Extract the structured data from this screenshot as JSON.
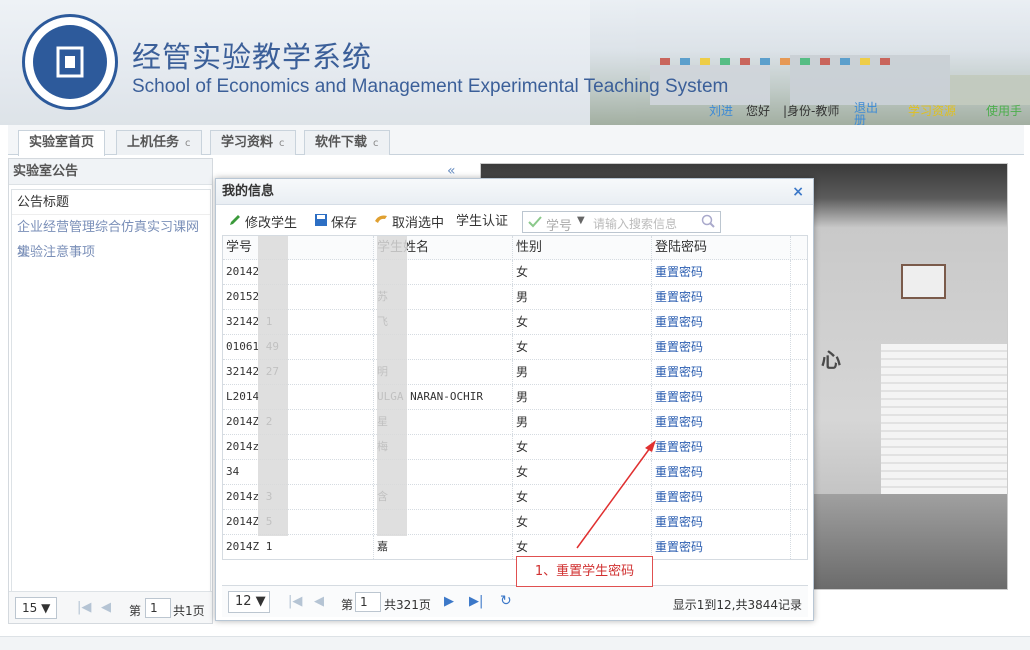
{
  "header": {
    "title_cn": "经管实验教学系统",
    "title_en": "School of Economics and Management Experimental Teaching System",
    "user": {
      "name": "刘进",
      "greeting": "您好",
      "identity": "|身份-教师",
      "logout": "退出",
      "logout2": "册",
      "link_yellow": "学习资源",
      "help": "使用手"
    }
  },
  "tabs": [
    {
      "label": "实验室首页"
    },
    {
      "label": "上机任务",
      "refresh": "c"
    },
    {
      "label": "学习资料",
      "refresh": "c"
    },
    {
      "label": "软件下载",
      "refresh": "c"
    }
  ],
  "left_panel": {
    "title": "实验室公告",
    "items": [
      "公告标题",
      "企业经营管理综合仿真实习课网址",
      "实验注意事项"
    ],
    "pager": {
      "size": "15 ▼",
      "page_prefix": "第",
      "page": "1",
      "total": "共1页"
    }
  },
  "collapse_icon": "«",
  "dialog": {
    "title": "我的信息",
    "close": "×",
    "toolbar": {
      "edit": "修改学生",
      "save": "保存",
      "cancel": "取消选中",
      "auth": "学生认证",
      "field": "学号",
      "placeholder": "请输入搜索信息"
    },
    "columns": [
      "学号",
      "学生姓名",
      "性别",
      "登陆密码"
    ],
    "rows": [
      {
        "id": "20142",
        "name": "",
        "gender": "女",
        "action": "重置密码"
      },
      {
        "id": "20152",
        "name": "苏",
        "gender": "男",
        "action": "重置密码"
      },
      {
        "id": "32142      1",
        "name": "飞",
        "gender": "女",
        "action": "重置密码"
      },
      {
        "id": "01061      49",
        "name": "",
        "gender": "女",
        "action": "重置密码"
      },
      {
        "id": "32142      27",
        "name": "明",
        "gender": "男",
        "action": "重置密码"
      },
      {
        "id": "L2014",
        "name": "ULGA NARAN-OCHIR",
        "gender": "男",
        "action": "重置密码"
      },
      {
        "id": "2014Z      2",
        "name": "星",
        "gender": "男",
        "action": "重置密码"
      },
      {
        "id": "2014z",
        "name": "梅",
        "gender": "女",
        "action": "重置密码"
      },
      {
        "id": "34",
        "name": "",
        "gender": "女",
        "action": "重置密码"
      },
      {
        "id": "2014z      3",
        "name": "含",
        "gender": "女",
        "action": "重置密码"
      },
      {
        "id": "2014Z      5",
        "name": "",
        "gender": "女",
        "action": "重置密码"
      },
      {
        "id": "2014Z      1",
        "name": "嘉",
        "gender": "女",
        "action": "重置密码"
      }
    ],
    "pager": {
      "size": "12 ▼",
      "page_prefix": "第",
      "page": "1",
      "total": "共321页",
      "summary": "显示1到12,共3844记录"
    }
  },
  "annotation": "1、重置学生密码",
  "colors": {
    "accent": "#3b5f99",
    "link": "#2a5db0",
    "annotation": "#e05050"
  }
}
